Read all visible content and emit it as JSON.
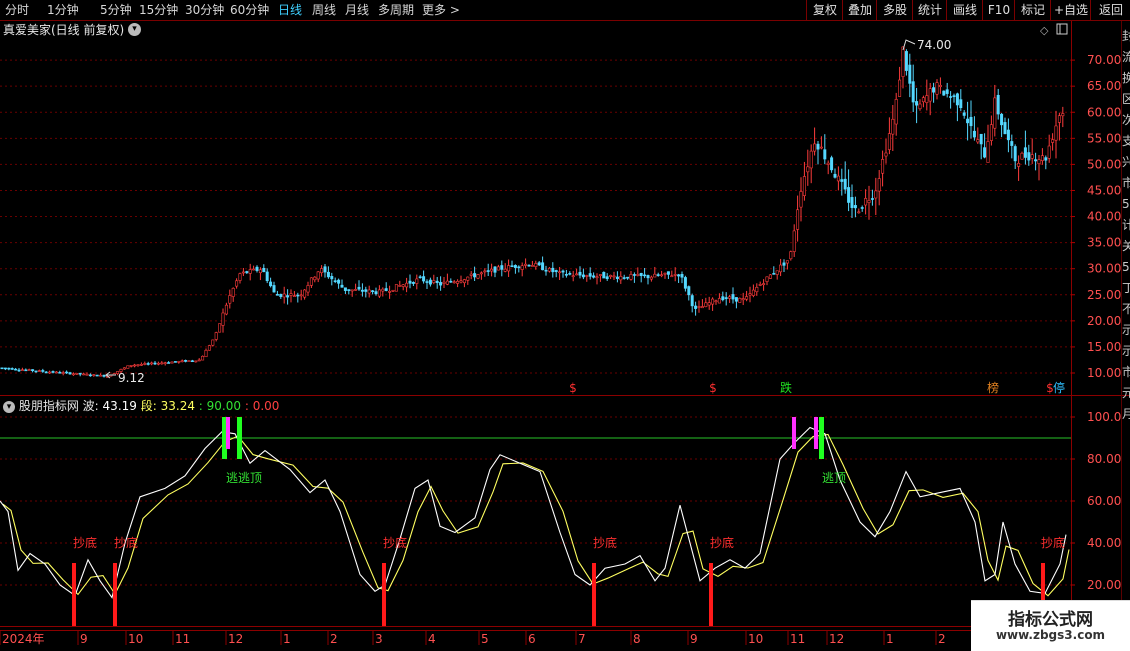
{
  "toolbar": {
    "periods": [
      "分时",
      "1分钟",
      "5分钟",
      "15分钟",
      "30分钟",
      "60分钟",
      "日线",
      "周线",
      "月线",
      "多周期",
      "更多"
    ],
    "active_period": "日线",
    "right_buttons": [
      "复权",
      "叠加",
      "多股",
      "统计",
      "画线",
      "F10",
      "标记",
      "+自选",
      "返回"
    ]
  },
  "main_pane": {
    "title": "真爱美家(日线 前复权)",
    "high_label": "74.00",
    "low_label": "9.12",
    "y_ticks": [
      "70.00",
      "65.00",
      "60.00",
      "55.00",
      "50.00",
      "45.00",
      "40.00",
      "35.00",
      "30.00",
      "25.00",
      "20.00",
      "15.00",
      "10.00"
    ],
    "markers": [
      "$",
      "$",
      "跌",
      "榜",
      "$",
      "停"
    ],
    "right_edge_chars": [
      "封",
      "流",
      "换",
      "区",
      "次",
      "支",
      "兴",
      "市",
      "5",
      "计",
      "关",
      "5",
      "丁",
      "不",
      "示",
      "示",
      "市",
      "元",
      "月"
    ]
  },
  "indicator_pane": {
    "name": "股朋指标网",
    "wave_label": "波:",
    "wave_value": "43.19",
    "seg_label": "段:",
    "seg_value": "33.24",
    "level_a": ": 90.00",
    "level_b": ": 0.00",
    "y_ticks": [
      "100.0",
      "80.00",
      "60.00",
      "40.00",
      "20.00"
    ],
    "signal_buy": "抄底",
    "signal_sell": "逃顶",
    "signal_sell_overlap": "逃逃顶"
  },
  "time_axis": {
    "labels": [
      "2024年",
      "9",
      "10",
      "11",
      "12",
      "1",
      "2",
      "3",
      "4",
      "5",
      "6",
      "7",
      "8",
      "9",
      "10",
      "11",
      "12",
      "1",
      "2"
    ]
  },
  "watermark": {
    "title": "指标公式网",
    "url": "www.zbgs3.com"
  },
  "colors": {
    "up": "#ff3c3c",
    "down": "#54d8ff",
    "wave": "#ffffff",
    "seg": "#ffff60",
    "level_line": "#29c229",
    "buy_bar": "#ff1a1a",
    "sell_bar": "#20ff20",
    "magenta_bar": "#ff30ff"
  }
}
